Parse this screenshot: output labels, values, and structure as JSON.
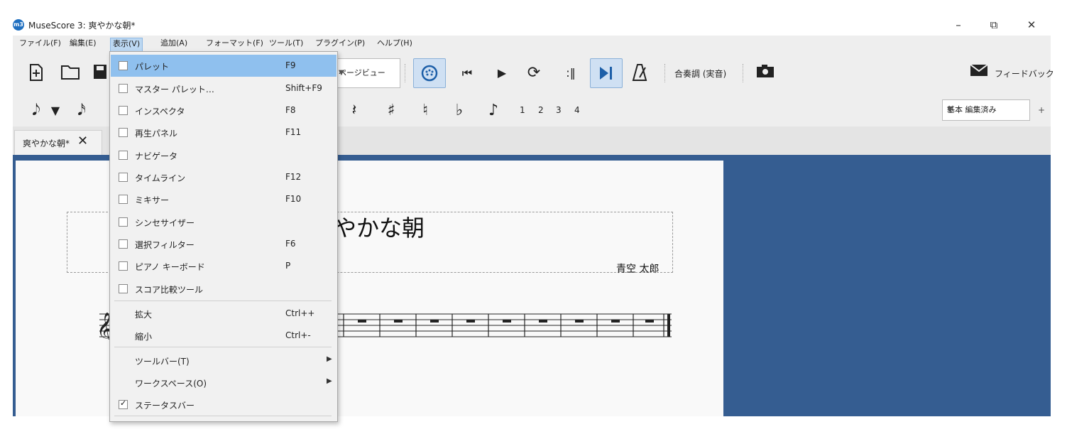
{
  "window": {
    "title": "MuseScore 3: 爽やかな朝*",
    "logo": "m3",
    "controls": {
      "minimize": "–",
      "restore": "⧉",
      "close": "✕"
    }
  },
  "menubar": [
    "ファイル(F)",
    "編集(E)",
    "表示(V)",
    "追加(A)",
    "フォーマット(F)",
    "ツール(T)",
    "プラグイン(P)",
    "ヘルプ(H)"
  ],
  "toolbar": {
    "view_mode": "ページビュー",
    "concert_pitch": "合奏調 (実音)",
    "feedback": "フィードバック"
  },
  "note_toolbar": {
    "voices": [
      "1",
      "2",
      "3",
      "4"
    ],
    "workspace": "基本 編集済み",
    "workspace_add": "+"
  },
  "tabs": [
    {
      "label": "爽やかな朝*",
      "close": "✕"
    }
  ],
  "score": {
    "title_visible": "やかな朝",
    "composer": "青空 太郎"
  },
  "view_menu": {
    "items": [
      {
        "label": "パレット",
        "shortcut": "F9",
        "checked": false,
        "highlighted": true
      },
      {
        "label": "マスター パレット…",
        "shortcut": "Shift+F9",
        "checked": false
      },
      {
        "label": "インスペクタ",
        "shortcut": "F8",
        "checked": false
      },
      {
        "label": "再生パネル",
        "shortcut": "F11",
        "checked": false
      },
      {
        "label": "ナビゲータ",
        "shortcut": "",
        "checked": false
      },
      {
        "label": "タイムライン",
        "shortcut": "F12",
        "checked": false
      },
      {
        "label": "ミキサー",
        "shortcut": "F10",
        "checked": false
      },
      {
        "label": "シンセサイザー",
        "shortcut": "",
        "checked": false
      },
      {
        "label": "選択フィルター",
        "shortcut": "F6",
        "checked": false
      },
      {
        "label": "ピアノ キーボード",
        "shortcut": "P",
        "checked": false
      },
      {
        "label": "スコア比較ツール",
        "shortcut": "",
        "checked": false
      }
    ],
    "zoom": [
      {
        "label": "拡大",
        "shortcut": "Ctrl++"
      },
      {
        "label": "縮小",
        "shortcut": "Ctrl+-"
      }
    ],
    "submenus": [
      {
        "label": "ツールバー(T)"
      },
      {
        "label": "ワークスペース(O)"
      }
    ],
    "status_bar": {
      "label": "ステータスバー",
      "checked": true
    }
  }
}
